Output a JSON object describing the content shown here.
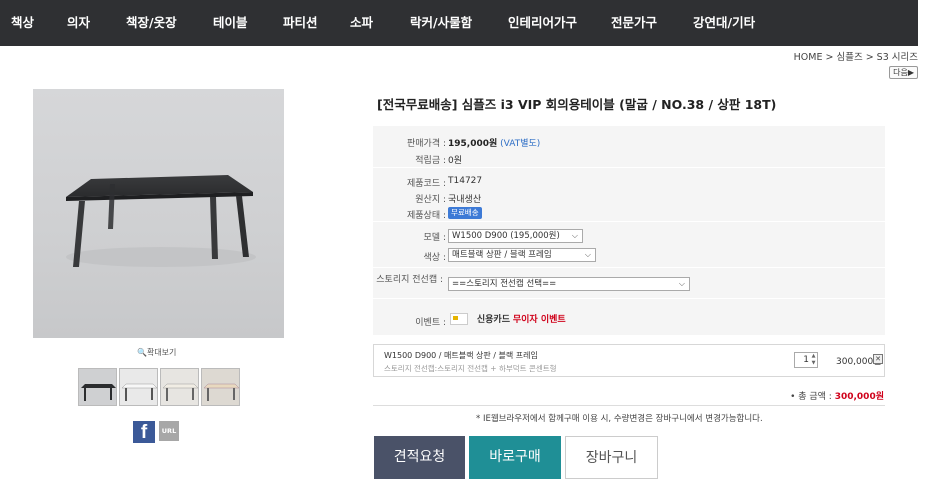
{
  "nav": {
    "items": [
      "책상",
      "의자",
      "책장/옷장",
      "테이블",
      "파티션",
      "소파",
      "락커/사물함",
      "인테리어가구",
      "전문가구",
      "강연대/기타"
    ]
  },
  "breadcrumb": "HOME > 심플즈 > S3 시리즈",
  "next_label": "다음▶",
  "gallery": {
    "zoom_label": "🔍확대보기",
    "share_url_label": "URL",
    "facebook_label": "f"
  },
  "product": {
    "title": "[전국무료배송] 심플즈 i3 VIP 회의용테이블 (말굽 / NO.38 / 상판 18T)",
    "price_label": "판매가격 :",
    "price_value": "195,000원",
    "price_vat": "(VAT별도)",
    "points_label": "적립금 :",
    "points_value": "0원",
    "code_label": "제품코드 :",
    "code_value": "T14727",
    "origin_label": "원산지 :",
    "origin_value": "국내생산",
    "status_label": "제품상태 :",
    "status_badge": "무료배송",
    "model_label": "모델 :",
    "model_value": "W1500 D900 (195,000원)",
    "color_label": "색상 :",
    "color_value": "매트블랙 상판 / 블랙 프레임",
    "storage_label": "스토리지 전선캡 :",
    "storage_value": "==스토리지 전선캡 선택==",
    "event_label": "이벤트 :",
    "event_text": "신용카드",
    "event_highlight": "무이자 이벤트"
  },
  "selected": {
    "name": "W1500 D900 / 매트블랙 상판 / 블랙 프레임",
    "sub": "스토리지 전선캡:스토리지 전선캡 + 하부덕트 콘센트형",
    "qty": "1",
    "price": "300,000원"
  },
  "total": {
    "label": "• 총 금액 :",
    "value": "300,000원"
  },
  "notice": "* IE웹브라우저에서 함께구매 이용 시, 수량변경은 장바구니에서 변경가능합니다.",
  "buttons": {
    "quote": "견적요청",
    "buy": "바로구매",
    "cart": "장바구니"
  },
  "colors": {
    "nav_bg": "#2f3033",
    "quote_btn": "#4a5268",
    "buy_btn": "#1f8f96",
    "accent_red": "#d0021b",
    "badge_blue": "#3d7ad6"
  }
}
